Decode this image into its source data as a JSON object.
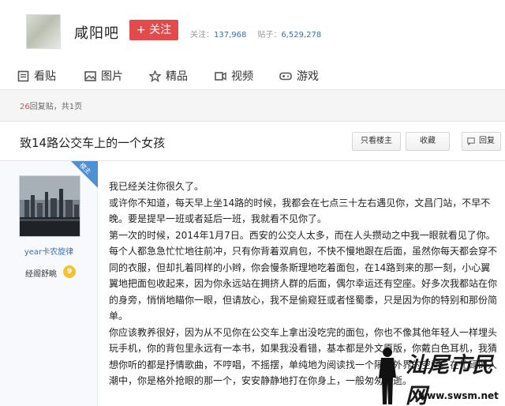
{
  "header": {
    "bar_name": "咸阳吧",
    "follow_label": "+ 关注",
    "follow_label_prefix": "+",
    "follow_text": "关注",
    "follows_label": "关注：",
    "follows_value": "137,968",
    "posts_label": "贴子：",
    "posts_value": "6,529,278"
  },
  "nav": {
    "items": [
      {
        "label": "看贴",
        "icon": "document-icon"
      },
      {
        "label": "图片",
        "icon": "image-icon"
      },
      {
        "label": "精品",
        "icon": "star-icon"
      },
      {
        "label": "视频",
        "icon": "video-icon"
      },
      {
        "label": "游戏",
        "icon": "gamepad-icon"
      }
    ]
  },
  "thread_info": {
    "reply_count": "26",
    "reply_suffix": "回复贴，共1页"
  },
  "thread": {
    "title": "致14路公交车上的一个女孩",
    "buttons": {
      "only_op": "只看楼主",
      "favorite": "收藏",
      "reply": "回复"
    }
  },
  "post": {
    "op_badge": "楼主",
    "username": "year卡农旋律",
    "level_name": "经阁舒眺",
    "level": "9",
    "paragraphs": [
      "我已经关注你很久了。",
      "或许你不知道，每天早上坐14路的时候，我都会在七点三十左右遇见你，文昌门站，不早不晚。要是提早一班或者延后一班，我就看不见你了。",
      "第一次的时候，2014年1月7日。西安的公交人太多，而在人头攒动之中我一眼就看见了你。每个人都急急忙忙地往前冲，只有你背着双肩包，不快不慢地跟在后面，虽然你每天都会穿不同的衣服，但却扎着同样的小辫，你会慢条斯理地吃着面包，在14路到来的那一刻，小心翼翼地把面包收起来，因为你永远站在拥挤人群的后面，偶尔幸运还有空座。好多次我都站在你的身旁，悄悄地瞄你一眼，但请放心，我不是偷窥狂或者怪蜀黍，只是因为你的特别和那份简单。",
      "你应该教养很好，因为从不见你在公交车上拿出没吃完的面包，你也不像其他年轻人一样埋头玩手机，你的背包里永远有一本书，如果我没看错，基本都是外文原版，你戴白色耳机，我猜想你听的都是抒情歌曲，不哼唱，不摇摆，单纯地为阅读找一个隔绝外界的空间。在忙碌的人潮中，你是格外抢眼的那一个，安安静静地打在你身上，一般匆匆而逝。"
    ]
  },
  "watermark": {
    "text": "汕尾市民网",
    "url": "www.swsm.net"
  },
  "colors": {
    "accent_red": "#e24b4b",
    "link_blue": "#3a6fb4",
    "op_badge_blue": "#4f8fd6",
    "level_gold": "#f2c232"
  }
}
